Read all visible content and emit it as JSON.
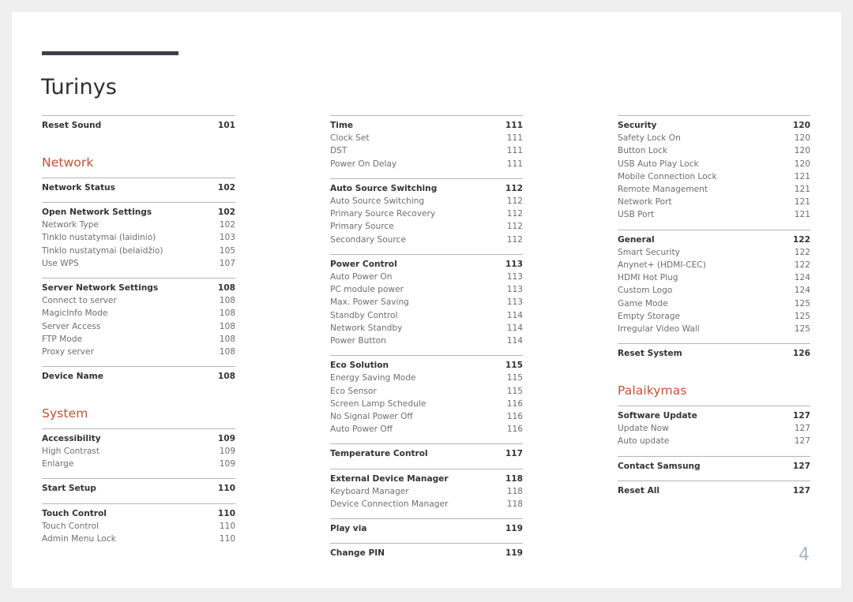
{
  "document": {
    "title": "Turinys",
    "page_number": "4",
    "accent_color": "#c35133",
    "rule_color": "#403e4a",
    "folio_color": "#a9b4c0"
  },
  "columns": [
    {
      "name": "column-1",
      "blocks": [
        {
          "type": "group",
          "entries": [
            {
              "label": "Reset Sound",
              "page": "101",
              "level": "main"
            }
          ]
        },
        {
          "type": "gap",
          "size": "lg"
        },
        {
          "type": "heading",
          "text": "Network"
        },
        {
          "type": "gap",
          "size": "sm"
        },
        {
          "type": "group",
          "entries": [
            {
              "label": "Network Status",
              "page": "102",
              "level": "main"
            }
          ]
        },
        {
          "type": "gap",
          "size": "sm"
        },
        {
          "type": "group",
          "entries": [
            {
              "label": "Open Network Settings",
              "page": "102",
              "level": "main"
            },
            {
              "label": "Network Type",
              "page": "102",
              "level": "sub"
            },
            {
              "label": "Tinklo nustatymai (laidinio)",
              "page": "103",
              "level": "sub"
            },
            {
              "label": "Tinklo nustatymai (belaidžio)",
              "page": "105",
              "level": "sub"
            },
            {
              "label": "Use WPS",
              "page": "107",
              "level": "sub"
            }
          ]
        },
        {
          "type": "gap",
          "size": "sm"
        },
        {
          "type": "group",
          "entries": [
            {
              "label": "Server Network Settings",
              "page": "108",
              "level": "main"
            },
            {
              "label": "Connect to server",
              "page": "108",
              "level": "sub"
            },
            {
              "label": "MagicInfo Mode",
              "page": "108",
              "level": "sub"
            },
            {
              "label": "Server Access",
              "page": "108",
              "level": "sub"
            },
            {
              "label": "FTP Mode",
              "page": "108",
              "level": "sub"
            },
            {
              "label": "Proxy server",
              "page": "108",
              "level": "sub"
            }
          ]
        },
        {
          "type": "gap",
          "size": "sm"
        },
        {
          "type": "group",
          "entries": [
            {
              "label": "Device Name",
              "page": "108",
              "level": "main"
            }
          ]
        },
        {
          "type": "gap",
          "size": "lg"
        },
        {
          "type": "heading",
          "text": "System"
        },
        {
          "type": "gap",
          "size": "sm"
        },
        {
          "type": "group",
          "entries": [
            {
              "label": "Accessibility",
              "page": "109",
              "level": "main"
            },
            {
              "label": "High Contrast",
              "page": "109",
              "level": "sub"
            },
            {
              "label": "Enlarge",
              "page": "109",
              "level": "sub"
            }
          ]
        },
        {
          "type": "gap",
          "size": "sm"
        },
        {
          "type": "group",
          "entries": [
            {
              "label": "Start Setup",
              "page": "110",
              "level": "main"
            }
          ]
        },
        {
          "type": "gap",
          "size": "sm"
        },
        {
          "type": "group",
          "entries": [
            {
              "label": "Touch Control",
              "page": "110",
              "level": "main"
            },
            {
              "label": "Touch Control",
              "page": "110",
              "level": "sub"
            },
            {
              "label": "Admin Menu Lock",
              "page": "110",
              "level": "sub"
            }
          ]
        }
      ]
    },
    {
      "name": "column-2",
      "blocks": [
        {
          "type": "group",
          "entries": [
            {
              "label": "Time",
              "page": "111",
              "level": "main"
            },
            {
              "label": "Clock Set",
              "page": "111",
              "level": "sub"
            },
            {
              "label": "DST",
              "page": "111",
              "level": "sub"
            },
            {
              "label": "Power On Delay",
              "page": "111",
              "level": "sub"
            }
          ]
        },
        {
          "type": "gap",
          "size": "sm"
        },
        {
          "type": "group",
          "entries": [
            {
              "label": "Auto Source Switching",
              "page": "112",
              "level": "main"
            },
            {
              "label": "Auto Source Switching",
              "page": "112",
              "level": "sub"
            },
            {
              "label": "Primary Source Recovery",
              "page": "112",
              "level": "sub"
            },
            {
              "label": "Primary Source",
              "page": "112",
              "level": "sub"
            },
            {
              "label": "Secondary Source",
              "page": "112",
              "level": "sub"
            }
          ]
        },
        {
          "type": "gap",
          "size": "sm"
        },
        {
          "type": "group",
          "entries": [
            {
              "label": "Power Control",
              "page": "113",
              "level": "main"
            },
            {
              "label": "Auto Power On",
              "page": "113",
              "level": "sub"
            },
            {
              "label": "PC module power",
              "page": "113",
              "level": "sub"
            },
            {
              "label": "Max. Power Saving",
              "page": "113",
              "level": "sub"
            },
            {
              "label": "Standby Control",
              "page": "114",
              "level": "sub"
            },
            {
              "label": "Network Standby",
              "page": "114",
              "level": "sub"
            },
            {
              "label": "Power Button",
              "page": "114",
              "level": "sub"
            }
          ]
        },
        {
          "type": "gap",
          "size": "sm"
        },
        {
          "type": "group",
          "entries": [
            {
              "label": "Eco Solution",
              "page": "115",
              "level": "main"
            },
            {
              "label": "Energy Saving Mode",
              "page": "115",
              "level": "sub"
            },
            {
              "label": "Eco Sensor",
              "page": "115",
              "level": "sub"
            },
            {
              "label": "Screen Lamp Schedule",
              "page": "116",
              "level": "sub"
            },
            {
              "label": "No Signal Power Off",
              "page": "116",
              "level": "sub"
            },
            {
              "label": "Auto Power Off",
              "page": "116",
              "level": "sub"
            }
          ]
        },
        {
          "type": "gap",
          "size": "sm"
        },
        {
          "type": "group",
          "entries": [
            {
              "label": "Temperature Control",
              "page": "117",
              "level": "main"
            }
          ]
        },
        {
          "type": "gap",
          "size": "sm"
        },
        {
          "type": "group",
          "entries": [
            {
              "label": "External Device Manager",
              "page": "118",
              "level": "main"
            },
            {
              "label": "Keyboard Manager",
              "page": "118",
              "level": "sub"
            },
            {
              "label": "Device Connection Manager",
              "page": "118",
              "level": "sub"
            }
          ]
        },
        {
          "type": "gap",
          "size": "sm"
        },
        {
          "type": "group",
          "entries": [
            {
              "label": "Play via",
              "page": "119",
              "level": "main"
            }
          ]
        },
        {
          "type": "gap",
          "size": "sm"
        },
        {
          "type": "group",
          "entries": [
            {
              "label": "Change PIN",
              "page": "119",
              "level": "main"
            }
          ]
        }
      ]
    },
    {
      "name": "column-3",
      "blocks": [
        {
          "type": "group",
          "entries": [
            {
              "label": "Security",
              "page": "120",
              "level": "main"
            },
            {
              "label": "Safety Lock On",
              "page": "120",
              "level": "sub"
            },
            {
              "label": "Button Lock",
              "page": "120",
              "level": "sub"
            },
            {
              "label": "USB Auto Play Lock",
              "page": "120",
              "level": "sub"
            },
            {
              "label": "Mobile Connection Lock",
              "page": "121",
              "level": "sub"
            },
            {
              "label": "Remote Management",
              "page": "121",
              "level": "sub"
            },
            {
              "label": "Network Port",
              "page": "121",
              "level": "sub"
            },
            {
              "label": "USB Port",
              "page": "121",
              "level": "sub"
            }
          ]
        },
        {
          "type": "gap",
          "size": "sm"
        },
        {
          "type": "group",
          "entries": [
            {
              "label": "General",
              "page": "122",
              "level": "main"
            },
            {
              "label": "Smart Security",
              "page": "122",
              "level": "sub"
            },
            {
              "label": "Anynet+ (HDMI-CEC)",
              "page": "122",
              "level": "sub"
            },
            {
              "label": "HDMI Hot Plug",
              "page": "124",
              "level": "sub"
            },
            {
              "label": "Custom Logo",
              "page": "124",
              "level": "sub"
            },
            {
              "label": "Game Mode",
              "page": "125",
              "level": "sub"
            },
            {
              "label": "Empty Storage",
              "page": "125",
              "level": "sub"
            },
            {
              "label": "Irregular Video Wall",
              "page": "125",
              "level": "sub"
            }
          ]
        },
        {
          "type": "gap",
          "size": "sm"
        },
        {
          "type": "group",
          "entries": [
            {
              "label": "Reset System",
              "page": "126",
              "level": "main"
            }
          ]
        },
        {
          "type": "gap",
          "size": "lg"
        },
        {
          "type": "heading",
          "text": "Palaikymas"
        },
        {
          "type": "gap",
          "size": "sm"
        },
        {
          "type": "group",
          "entries": [
            {
              "label": "Software Update",
              "page": "127",
              "level": "main"
            },
            {
              "label": "Update Now",
              "page": "127",
              "level": "sub"
            },
            {
              "label": "Auto update",
              "page": "127",
              "level": "sub"
            }
          ]
        },
        {
          "type": "gap",
          "size": "sm"
        },
        {
          "type": "group",
          "entries": [
            {
              "label": "Contact Samsung",
              "page": "127",
              "level": "main"
            }
          ]
        },
        {
          "type": "gap",
          "size": "sm"
        },
        {
          "type": "group",
          "entries": [
            {
              "label": "Reset All",
              "page": "127",
              "level": "main"
            }
          ]
        }
      ]
    }
  ]
}
